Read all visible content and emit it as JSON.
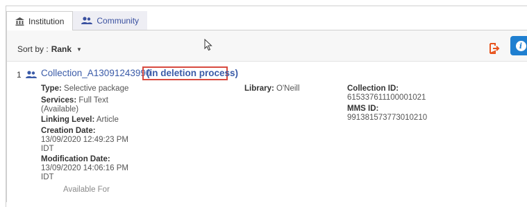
{
  "tabs": [
    {
      "label": "Institution",
      "icon": "institution-icon"
    },
    {
      "label": "Community",
      "icon": "users-icon"
    }
  ],
  "toolbar": {
    "sort_prefix": "Sort by : ",
    "sort_value": "Rank"
  },
  "result": {
    "number": "1",
    "title": "Collection_A13091243990",
    "deletion_status": "(in deletion process)",
    "type_label": "Type:",
    "type_value": "Selective package",
    "services_label": "Services:",
    "services_value_1": "Full Text",
    "services_value_2": "(Available)",
    "linking_label": "Linking Level:",
    "linking_value": "Article",
    "creation_label": "Creation Date:",
    "creation_value_1": "13/09/2020 12:49:23 PM",
    "creation_value_2": "IDT",
    "modification_label": "Modification Date:",
    "modification_value_1": "13/09/2020 14:06:16 PM",
    "modification_value_2": "IDT",
    "library_label": "Library:",
    "library_value": "O'Neill",
    "collection_id_label": "Collection ID:",
    "collection_id_value": "615337611100001021",
    "mms_id_label": "MMS ID:",
    "mms_id_value": "991381573773010210",
    "available_for": "Available For"
  },
  "colors": {
    "link": "#3a5ba8",
    "highlight_border": "#d84a3f",
    "info_button": "#1f7fd0",
    "export_icon": "#e8541e"
  }
}
